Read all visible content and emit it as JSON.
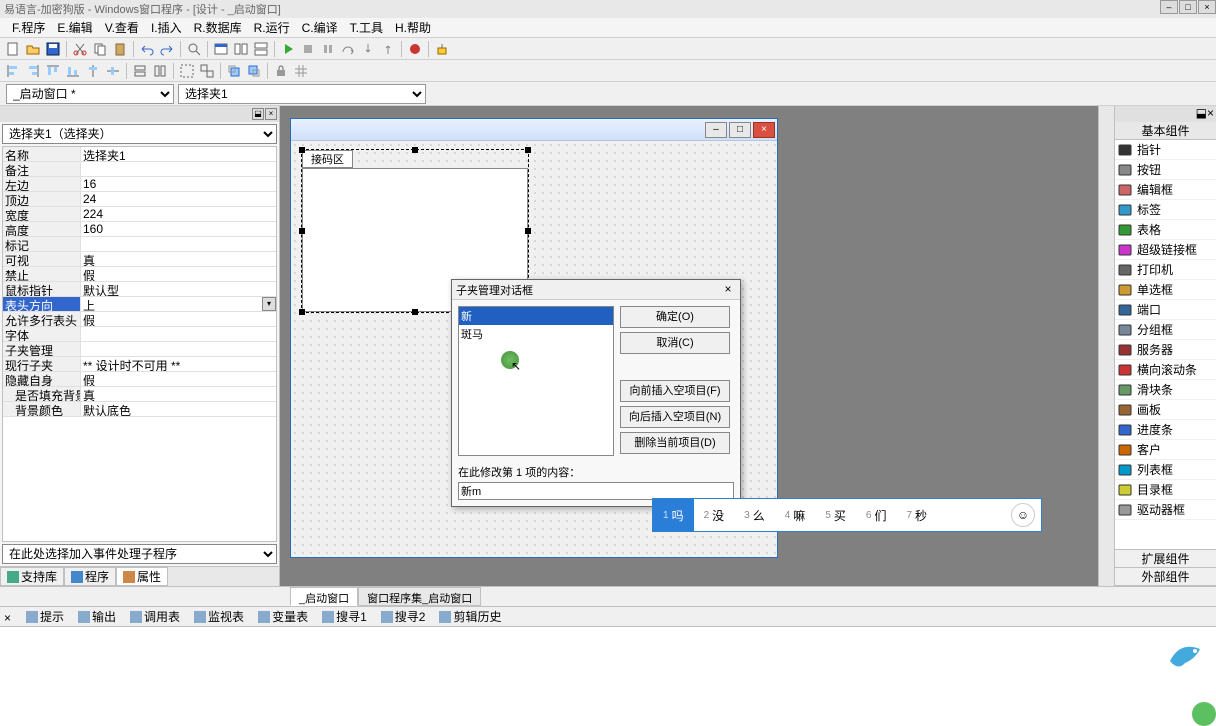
{
  "title": "易语言-加密狗版 - Windows窗口程序 - [设计 - _启动窗口]",
  "menu": [
    "F.程序",
    "E.编辑",
    "V.查看",
    "I.插入",
    "R.数据库",
    "R.运行",
    "C.编译",
    "T.工具",
    "H.帮助"
  ],
  "combo1": "_启动窗口 *",
  "combo2": "选择夹1",
  "prop_combo": "选择夹1（选择夹）",
  "props": [
    {
      "name": "名称",
      "val": "选择夹1"
    },
    {
      "name": "备注",
      "val": ""
    },
    {
      "name": "左边",
      "val": "16"
    },
    {
      "name": "顶边",
      "val": "24"
    },
    {
      "name": "宽度",
      "val": "224"
    },
    {
      "name": "高度",
      "val": "160"
    },
    {
      "name": "标记",
      "val": ""
    },
    {
      "name": "可视",
      "val": "真"
    },
    {
      "name": "禁止",
      "val": "假"
    },
    {
      "name": "鼠标指针",
      "val": "默认型"
    },
    {
      "name": "表头方向",
      "val": "上",
      "sel": true,
      "dd": true
    },
    {
      "name": "允许多行表头",
      "val": "假"
    },
    {
      "name": "字体",
      "val": ""
    },
    {
      "name": "子夹管理",
      "val": ""
    },
    {
      "name": "现行子夹",
      "val": "** 设计时不可用 **"
    },
    {
      "name": "隐藏自身",
      "val": "假"
    },
    {
      "name": "是否填充背景",
      "val": "真",
      "indent": true
    },
    {
      "name": "背景颜色",
      "val": "默认底色",
      "indent": true
    }
  ],
  "events_combo": "在此处选择加入事件处理子程序",
  "left_tabs": [
    {
      "label": "支持库",
      "ico": "#4a8"
    },
    {
      "label": "程序",
      "ico": "#48c"
    },
    {
      "label": "属性",
      "ico": "#c84",
      "active": true
    }
  ],
  "tab_control_label": "接码区",
  "dialog": {
    "title": "子夹管理对话框",
    "items": [
      "新",
      "斑马"
    ],
    "sel": 0,
    "btns_top": [
      "确定(O)",
      "取消(C)"
    ],
    "btns_bot": [
      "向前插入空项目(F)",
      "向后插入空项目(N)",
      "删除当前项目(D)"
    ],
    "edit_label": "在此修改第 1 项的内容：",
    "edit_value": "新m"
  },
  "ime": {
    "candidates": [
      {
        "n": "1",
        "t": "吗"
      },
      {
        "n": "2",
        "t": "没"
      },
      {
        "n": "3",
        "t": "么"
      },
      {
        "n": "4",
        "t": "嘛"
      },
      {
        "n": "5",
        "t": "买"
      },
      {
        "n": "6",
        "t": "们"
      },
      {
        "n": "7",
        "t": "秒"
      }
    ]
  },
  "right": {
    "title": "基本组件",
    "items": [
      {
        "label": "指针",
        "c": "#333"
      },
      {
        "label": "按钮",
        "c": "#888"
      },
      {
        "label": "编辑框",
        "c": "#c66"
      },
      {
        "label": "标签",
        "c": "#39c"
      },
      {
        "label": "表格",
        "c": "#393"
      },
      {
        "label": "超级链接框",
        "c": "#c3c"
      },
      {
        "label": "打印机",
        "c": "#666"
      },
      {
        "label": "单选框",
        "c": "#c93"
      },
      {
        "label": "端口",
        "c": "#369"
      },
      {
        "label": "分组框",
        "c": "#789"
      },
      {
        "label": "服务器",
        "c": "#933"
      },
      {
        "label": "横向滚动条",
        "c": "#c33"
      },
      {
        "label": "滑块条",
        "c": "#696"
      },
      {
        "label": "画板",
        "c": "#963"
      },
      {
        "label": "进度条",
        "c": "#36c"
      },
      {
        "label": "客户",
        "c": "#c60"
      },
      {
        "label": "列表框",
        "c": "#09c"
      },
      {
        "label": "目录框",
        "c": "#cc3"
      },
      {
        "label": "驱动器框",
        "c": "#999"
      }
    ],
    "tabs": [
      "扩展组件",
      "外部组件"
    ]
  },
  "bottom_tabs": [
    {
      "label": "_启动窗口",
      "active": true
    },
    {
      "label": "窗口程序集_启动窗口"
    }
  ],
  "out_tabs": [
    "提示",
    "输出",
    "调用表",
    "监视表",
    "变量表",
    "搜寻1",
    "搜寻2",
    "剪辑历史"
  ]
}
